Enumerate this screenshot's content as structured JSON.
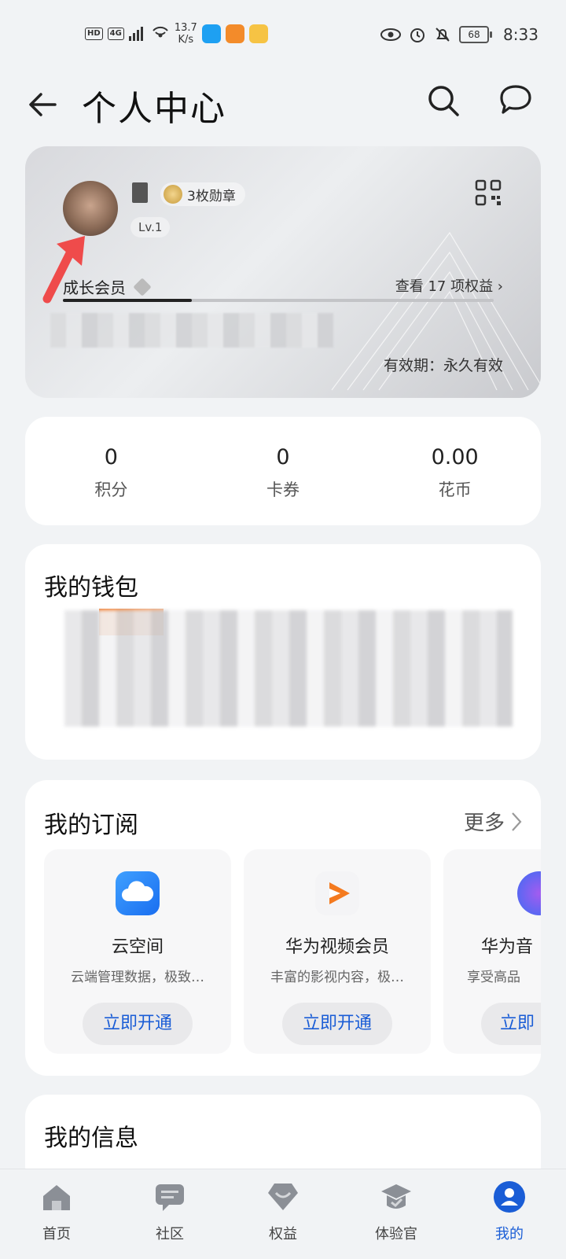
{
  "status_bar": {
    "left_badges": [
      "HD",
      "4G"
    ],
    "net_speed": "13.7\nK/s",
    "battery": "68",
    "time": "8:33"
  },
  "header": {
    "title": "个人中心"
  },
  "member_card": {
    "medal_text": "3枚勋章",
    "level": "Lv.1",
    "tier": "成长会员",
    "benefits_link": "查看 17 项权益 ›",
    "progress": 0.3,
    "validity": "有效期：永久有效"
  },
  "stats": [
    {
      "value": "0",
      "label": "积分"
    },
    {
      "value": "0",
      "label": "卡券"
    },
    {
      "value": "0.00",
      "label": "花币"
    }
  ],
  "wallet": {
    "title": "我的钱包"
  },
  "subscriptions": {
    "title": "我的订阅",
    "more": "更多",
    "items": [
      {
        "name": "云空间",
        "desc": "云端管理数据，极致…",
        "button": "立即开通"
      },
      {
        "name": "华为视频会员",
        "desc": "丰富的影视内容，极…",
        "button": "立即开通"
      },
      {
        "name": "华为音",
        "desc": "享受高品",
        "button": "立即"
      }
    ]
  },
  "info": {
    "title": "我的信息"
  },
  "tabbar": [
    {
      "label": "首页",
      "icon": "home-icon"
    },
    {
      "label": "社区",
      "icon": "community-icon"
    },
    {
      "label": "权益",
      "icon": "benefits-icon"
    },
    {
      "label": "体验官",
      "icon": "experience-icon"
    },
    {
      "label": "我的",
      "icon": "profile-icon"
    }
  ],
  "colors": {
    "accent": "#1a5dd6",
    "background": "#f1f3f5",
    "arrow": "#ef4b4b"
  }
}
